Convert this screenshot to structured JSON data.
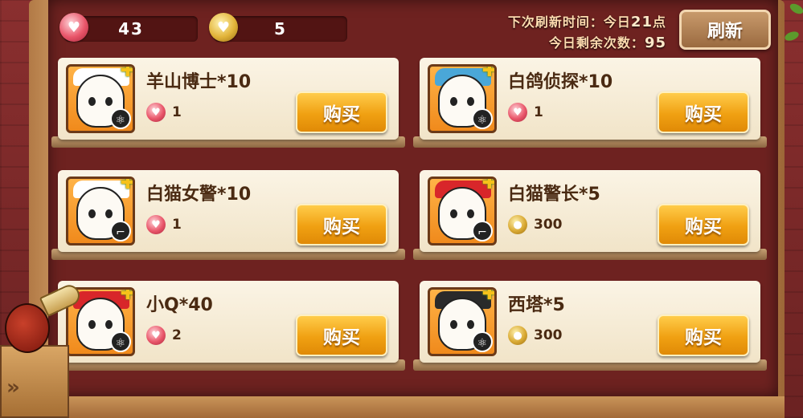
{
  "currency": {
    "gems": "43",
    "gold": "5"
  },
  "refresh": {
    "next_time_label": "下次刷新时间：今日",
    "next_time_value": "21",
    "next_time_unit": "点",
    "remaining_label": "今日剩余次数：",
    "remaining_value": "95",
    "button_label": "刷新"
  },
  "items": [
    {
      "name": "羊山博士*10",
      "price": "1",
      "currency": "gem",
      "buy_label": "购买",
      "hat_color": "#ffffff",
      "type_icon": "atom-icon"
    },
    {
      "name": "白鸽侦探*10",
      "price": "1",
      "currency": "gem",
      "buy_label": "购买",
      "hat_color": "#4aa7d8",
      "type_icon": "atom-icon"
    },
    {
      "name": "白猫女警*10",
      "price": "1",
      "currency": "gem",
      "buy_label": "购买",
      "hat_color": "#ffffff",
      "type_icon": "gun-icon"
    },
    {
      "name": "白猫警长*5",
      "price": "300",
      "currency": "gold",
      "buy_label": "购买",
      "hat_color": "#d8262a",
      "type_icon": "gun-icon"
    },
    {
      "name": "小Q*40",
      "price": "2",
      "currency": "gem",
      "buy_label": "购买",
      "hat_color": "#d8262a",
      "type_icon": "atom-icon"
    },
    {
      "name": "西塔*5",
      "price": "300",
      "currency": "gold",
      "buy_label": "购买",
      "hat_color": "#2a2a2a",
      "type_icon": "atom-icon"
    }
  ]
}
